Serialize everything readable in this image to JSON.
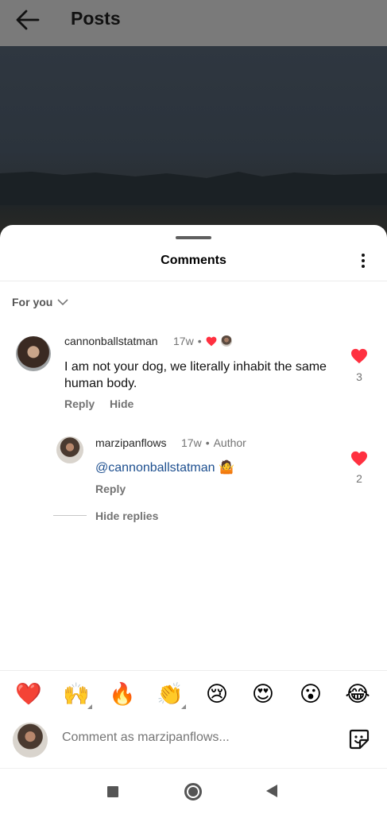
{
  "header": {
    "title": "Posts",
    "back_icon": "arrow-left-icon"
  },
  "sheet": {
    "title": "Comments",
    "filter_label": "For you"
  },
  "comments": [
    {
      "username": "cannonballstatman",
      "time": "17w",
      "text": "I am not your dog, we literally inhabit the same human body.",
      "reply_label": "Reply",
      "hide_label": "Hide",
      "like_count": "3",
      "liked_by_author": true,
      "replies": [
        {
          "username": "marzipanflows",
          "time": "17w",
          "badge": "Author",
          "mention": "@cannonballstatman",
          "emoji": "🤷",
          "reply_label": "Reply",
          "like_count": "2"
        }
      ],
      "hide_replies_label": "Hide replies"
    }
  ],
  "quick_reactions": [
    "❤️",
    "🙌",
    "🔥",
    "👏",
    "😢",
    "😍",
    "😮",
    "😂"
  ],
  "composer": {
    "placeholder": "Comment as marzipanflows..."
  },
  "colors": {
    "like_red": "#ff3040",
    "mention_blue": "#1d4f8f",
    "muted_text": "#737373"
  }
}
